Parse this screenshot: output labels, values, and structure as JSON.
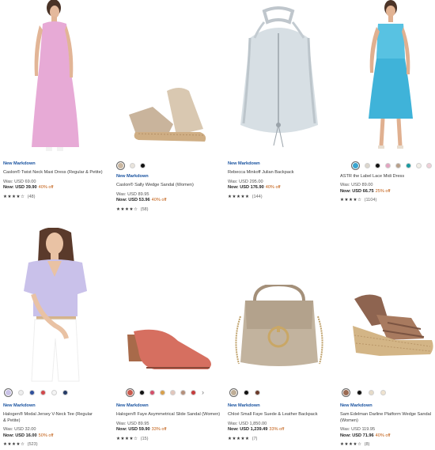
{
  "products": [
    {
      "badge": "New Markdown",
      "name": "Caslon® Twist Neck Maxi Dress (Regular & Petite)",
      "was": "Was: USD 69.00",
      "now": "Now: USD 39.90",
      "pct": "40% off",
      "stars": "★★★★☆",
      "reviews": "(48)",
      "image_icon": "pink-maxi-dress",
      "swatch_colors": [],
      "selected_swatch": -1
    },
    {
      "badge": "New Markdown",
      "name": "Caslon® Sally Wedge Sandal (Women)",
      "was": "Was: USD 89.95",
      "now": "Now: USD 53.96",
      "pct": "40% off",
      "stars": "★★★★☆",
      "reviews": "(58)",
      "image_icon": "tan-wedge-sandal",
      "swatch_colors": [
        "#c9b6a0",
        "#e9e4dc",
        "#111111"
      ],
      "selected_swatch": 0
    },
    {
      "badge": "New Markdown",
      "name": "Rebecca Minkoff Julian Backpack",
      "was": "Was: USD 295.00",
      "now": "Now: USD 176.90",
      "pct": "40% off",
      "stars": "★★★★★",
      "reviews": "(144)",
      "image_icon": "light-blue-backpack",
      "swatch_colors": [],
      "selected_swatch": -1
    },
    {
      "badge": "",
      "name": "ASTR the Label Lace Midi Dress",
      "was": "Was: USD 89.00",
      "now": "Now: USD 66.75",
      "pct": "25% off",
      "stars": "★★★★☆",
      "reviews": "(1104)",
      "image_icon": "blue-lace-midi-dress",
      "swatch_colors": [
        "#3aa5cf",
        "#dcd6cc",
        "#111111",
        "#e3a4c0",
        "#b8a08a",
        "#1a9aa0",
        "#f1eee7",
        "#efcfd8"
      ],
      "selected_swatch": 0
    },
    {
      "badge": "New Markdown",
      "name": "Halogen® Modal Jersey V-Neck Tee (Regular & Petite)",
      "was": "Was: USD 32.00",
      "now": "Now: USD 16.00",
      "pct": "50% off",
      "stars": "★★★★☆",
      "reviews": "(523)",
      "image_icon": "lavender-v-neck-tee",
      "swatch_colors": [
        "#c9c2e6",
        "#eeeeee",
        "#2f4f9c",
        "#d2474a",
        "#f4f4f4",
        "#243a66"
      ],
      "selected_swatch": 0
    },
    {
      "badge": "New Markdown",
      "name": "Halogen® Faye Asymmetrical Slide Sandal (Women)",
      "was": "Was: USD 89.95",
      "now": "Now: USD 59.90",
      "pct": "33% off",
      "stars": "★★★★☆",
      "reviews": "(15)",
      "image_icon": "coral-block-heel-slide",
      "swatch_colors": [
        "#c85a4e",
        "#111111",
        "#d44f6a",
        "#d9a04a",
        "#e2c6bb",
        "#b58f7a",
        "#c63b3b"
      ],
      "selected_swatch": 0
    },
    {
      "badge": "New Markdown",
      "name": "Chloé Small Faye Suede & Leather Backpack",
      "was": "Was: USD 1,850.00",
      "now": "Now: USD 1,239.49",
      "pct": "33% off",
      "stars": "★★★★★",
      "reviews": "(7)",
      "image_icon": "taupe-suede-backpack",
      "swatch_colors": [
        "#bfae97",
        "#111111",
        "#6b3a2a"
      ],
      "selected_swatch": 0
    },
    {
      "badge": "New Markdown",
      "name": "Sam Edelman Darline Platform Wedge Sandal (Women)",
      "was": "Was: USD 119.95",
      "now": "Now: USD 71.96",
      "pct": "40% off",
      "stars": "★★★★☆",
      "reviews": "(8)",
      "image_icon": "brown-platform-wedge",
      "swatch_colors": [
        "#9a6a52",
        "#111111",
        "#e6dbc8",
        "#efe3cf"
      ],
      "selected_swatch": 0
    }
  ]
}
